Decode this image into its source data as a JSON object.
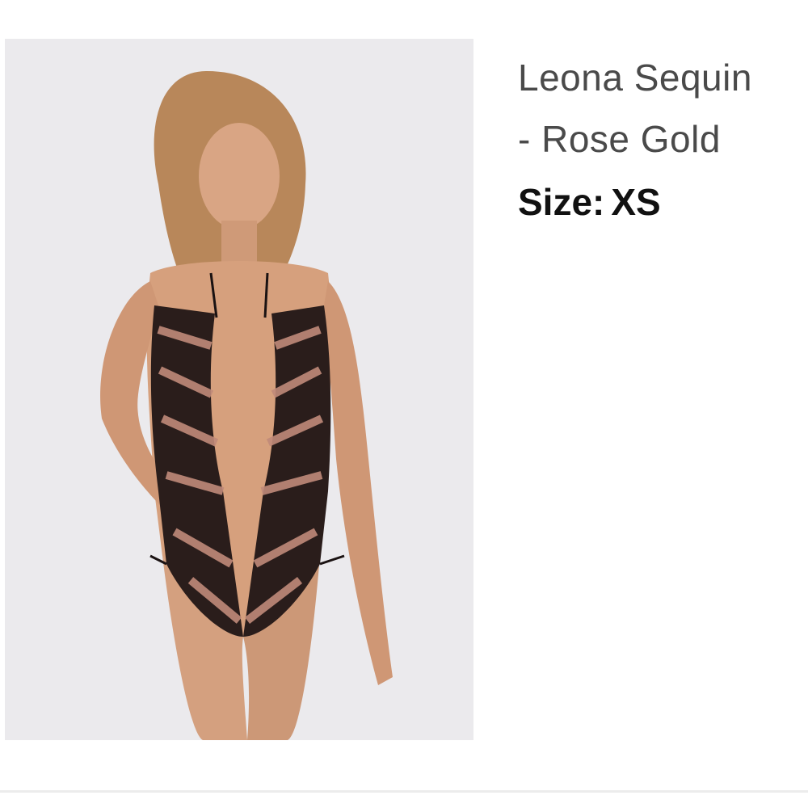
{
  "product": {
    "title_line1": "Leona Sequin",
    "title_line2": "- Rose Gold",
    "size_label": "Size:",
    "size_value": "XS"
  },
  "colors": {
    "image_background": "#ebeaed",
    "title_text": "#4a4a4a",
    "size_text": "#111111",
    "divider": "#ececec"
  },
  "icons": {
    "product_image": "product-photo-placeholder"
  }
}
